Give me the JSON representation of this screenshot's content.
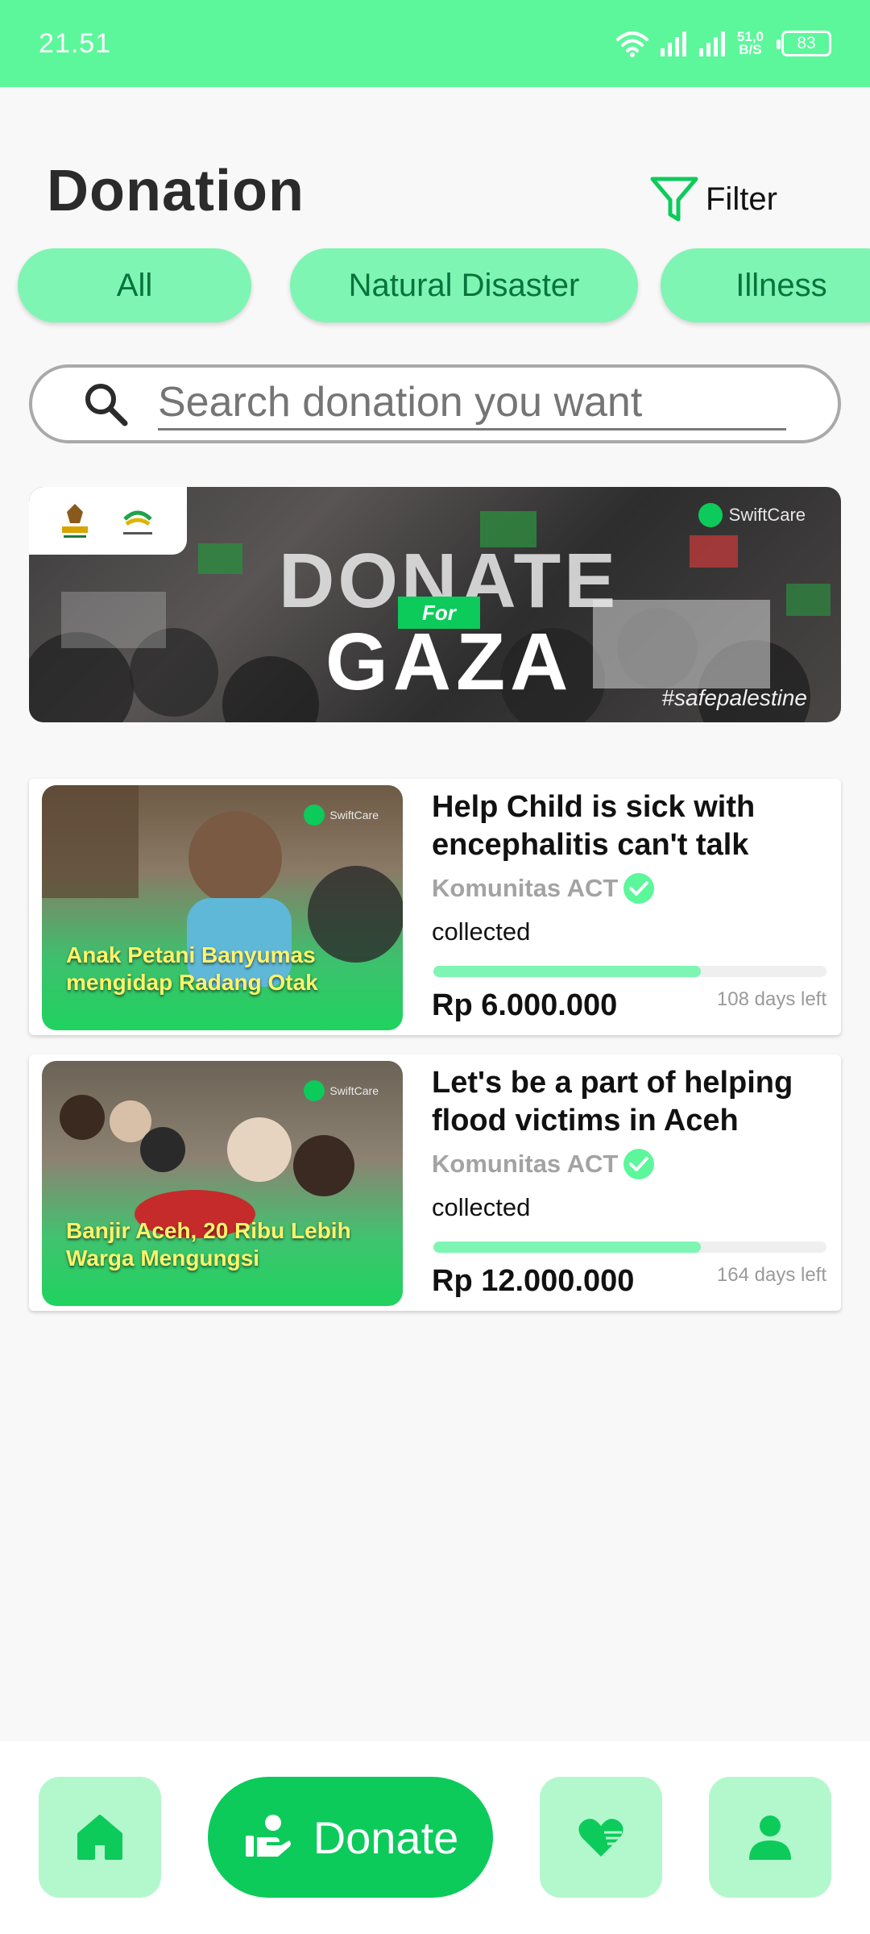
{
  "status_bar": {
    "time": "21.51",
    "net_speed_value": "51,0",
    "net_speed_unit": "B/S",
    "battery": "83"
  },
  "header": {
    "title": "Donation",
    "filter_label": "Filter"
  },
  "categories": [
    {
      "label": "All"
    },
    {
      "label": "Natural Disaster"
    },
    {
      "label": "Illness"
    }
  ],
  "search": {
    "placeholder": "Search donation you want"
  },
  "banner": {
    "brand": "SwiftCare",
    "headline_top": "DONATE",
    "headline_for": "For",
    "headline_bottom": "GAZA",
    "hashtag": "#safepalestine"
  },
  "donations": [
    {
      "image_caption": "Anak Petani Banyumas mengidap Radang Otak",
      "image_brand": "SwiftCare",
      "title": "Help Child is sick with encephalitis can't talk",
      "organizer": "Komunitas ACT",
      "collected_label": "collected",
      "progress": 0.68,
      "amount": "Rp 6.000.000",
      "days_left": "108 days left"
    },
    {
      "image_caption": "Banjir Aceh, 20 Ribu Lebih Warga Mengungsi",
      "image_brand": "SwiftCare",
      "title": "Let's be a part of helping flood victims in Aceh",
      "organizer": "Komunitas ACT",
      "collected_label": "collected",
      "progress": 0.68,
      "amount": "Rp 12.000.000",
      "days_left": "164 days left"
    }
  ],
  "bottom_nav": {
    "donate_label": "Donate"
  },
  "colors": {
    "status_bar": "#5cf79b",
    "chip": "#7ff5b3",
    "primary": "#0ccb5b",
    "nav_light": "#b3f8cd"
  },
  "icons": {
    "filter": "filter-icon",
    "search": "search-icon",
    "verified": "verified-check-icon",
    "home": "home-icon",
    "donate": "hand-donate-icon",
    "heart": "heart-icon",
    "profile": "user-icon"
  }
}
